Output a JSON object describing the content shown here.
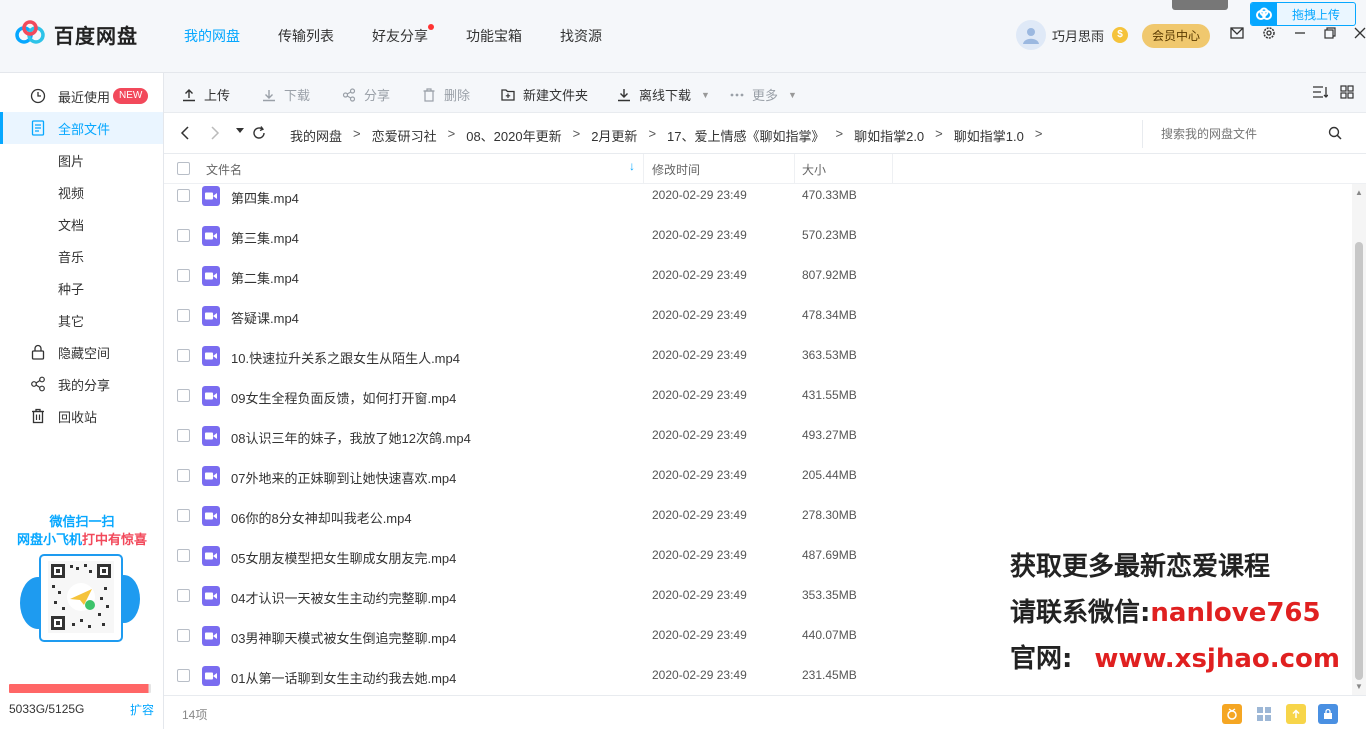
{
  "app": {
    "name": "百度网盘",
    "drag_upload_label": "拖拽上传"
  },
  "nav": {
    "items": [
      {
        "label": "我的网盘",
        "active": true
      },
      {
        "label": "传输列表",
        "active": false
      },
      {
        "label": "好友分享",
        "active": false,
        "dot": true
      },
      {
        "label": "功能宝箱",
        "active": false
      },
      {
        "label": "找资源",
        "active": false
      }
    ]
  },
  "user": {
    "name": "巧月思雨",
    "level_badge": "$",
    "vip_button": "会员中心"
  },
  "sidebar": {
    "items": [
      {
        "label": "最近使用",
        "icon": "clock-icon",
        "badge": "NEW"
      },
      {
        "label": "全部文件",
        "icon": "document-icon",
        "active": true
      },
      {
        "label": "图片",
        "icon": ""
      },
      {
        "label": "视频",
        "icon": ""
      },
      {
        "label": "文档",
        "icon": ""
      },
      {
        "label": "音乐",
        "icon": ""
      },
      {
        "label": "种子",
        "icon": ""
      },
      {
        "label": "其它",
        "icon": ""
      },
      {
        "label": "隐藏空间",
        "icon": "lock-icon"
      },
      {
        "label": "我的分享",
        "icon": "share-icon"
      },
      {
        "label": "回收站",
        "icon": "trash-icon"
      }
    ],
    "promo_line1": "微信扫一扫",
    "promo_line2_a": "网盘小飞机",
    "promo_line2_b": "打中有惊喜",
    "quota": "5033G/5125G",
    "quota_fraction": 0.982,
    "expand": "扩容"
  },
  "toolbar": {
    "upload": "上传",
    "download": "下载",
    "share": "分享",
    "delete": "删除",
    "new_folder": "新建文件夹",
    "offline_download": "离线下载",
    "more": "更多"
  },
  "path": {
    "crumbs": [
      "我的网盘",
      "恋爱研习社",
      "08、2020年更新",
      "2月更新",
      "17、爱上情感《聊如指掌》",
      "聊如指掌2.0",
      "聊如指掌1.0"
    ],
    "search_placeholder": "搜索我的网盘文件"
  },
  "table": {
    "headers": {
      "name": "文件名",
      "modified": "修改时间",
      "size": "大小"
    },
    "rows": [
      {
        "name": "第四集.mp4",
        "modified": "2020-02-29 23:49",
        "size": "470.33MB"
      },
      {
        "name": "第三集.mp4",
        "modified": "2020-02-29 23:49",
        "size": "570.23MB"
      },
      {
        "name": "第二集.mp4",
        "modified": "2020-02-29 23:49",
        "size": "807.92MB"
      },
      {
        "name": "答疑课.mp4",
        "modified": "2020-02-29 23:49",
        "size": "478.34MB"
      },
      {
        "name": "10.快速拉升关系之跟女生从陌生人.mp4",
        "modified": "2020-02-29 23:49",
        "size": "363.53MB"
      },
      {
        "name": "09女生全程负面反馈，如何打开窗.mp4",
        "modified": "2020-02-29 23:49",
        "size": "431.55MB"
      },
      {
        "name": "08认识三年的妹子，我放了她12次鸽.mp4",
        "modified": "2020-02-29 23:49",
        "size": "493.27MB"
      },
      {
        "name": "07外地来的正妹聊到让她快速喜欢.mp4",
        "modified": "2020-02-29 23:49",
        "size": "205.44MB"
      },
      {
        "name": "06你的8分女神却叫我老公.mp4",
        "modified": "2020-02-29 23:49",
        "size": "278.30MB"
      },
      {
        "name": "05女朋友模型把女生聊成女朋友完.mp4",
        "modified": "2020-02-29 23:49",
        "size": "487.69MB"
      },
      {
        "name": "04才认识一天被女生主动约完整聊.mp4",
        "modified": "2020-02-29 23:49",
        "size": "353.35MB"
      },
      {
        "name": "03男神聊天模式被女生倒追完整聊.mp4",
        "modified": "2020-02-29 23:49",
        "size": "440.07MB"
      },
      {
        "name": "01从第一话聊到女生主动约我去她.mp4",
        "modified": "2020-02-29 23:49",
        "size": "231.45MB"
      }
    ]
  },
  "status": {
    "item_count": "14项"
  },
  "watermark": {
    "line1": "获取更多最新恋爱课程",
    "line2_label": "请联系微信:",
    "line2_value": "nanlove765",
    "line3_label": "官网:",
    "line3_value": "www.xsjhao.com"
  },
  "colors": {
    "accent": "#06a7ff",
    "video_icon": "#7a6cf0",
    "quota_bar": "#ff6666",
    "watermark_red": "#e02020"
  }
}
